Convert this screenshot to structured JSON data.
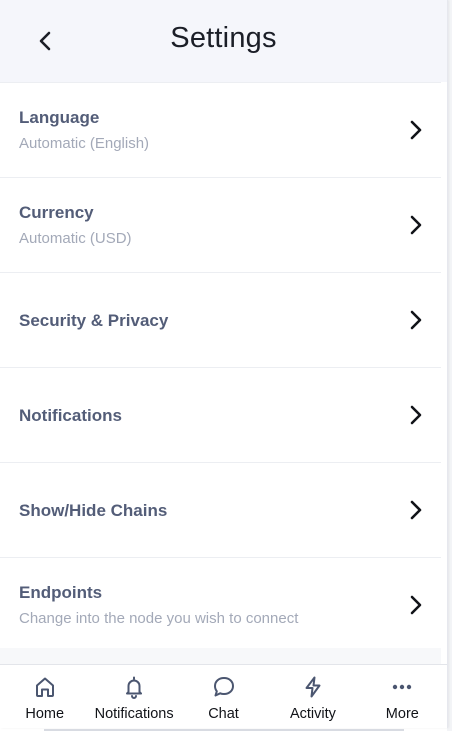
{
  "header": {
    "title": "Settings"
  },
  "icons": {
    "back": "chevron-left-icon",
    "row_arrow": "chevron-right-icon"
  },
  "settings": {
    "items": [
      {
        "title": "Language",
        "subtitle": "Automatic (English)"
      },
      {
        "title": "Currency",
        "subtitle": "Automatic (USD)"
      },
      {
        "title": "Security & Privacy",
        "subtitle": ""
      },
      {
        "title": "Notifications",
        "subtitle": ""
      },
      {
        "title": "Show/Hide Chains",
        "subtitle": ""
      },
      {
        "title": "Endpoints",
        "subtitle": "Change into the node you wish to connect"
      }
    ]
  },
  "tabbar": {
    "items": [
      {
        "label": "Home",
        "icon": "home-icon"
      },
      {
        "label": "Notifications",
        "icon": "bell-icon"
      },
      {
        "label": "Chat",
        "icon": "chat-bubble-icon"
      },
      {
        "label": "Activity",
        "icon": "lightning-icon"
      },
      {
        "label": "More",
        "icon": "more-dots-icon"
      }
    ]
  },
  "colors": {
    "header_bg": "#f5f6fb",
    "title_text": "#1b1e27",
    "row_title": "#535d78",
    "row_subtitle": "#a3a9b8",
    "divider": "#eceef2"
  }
}
